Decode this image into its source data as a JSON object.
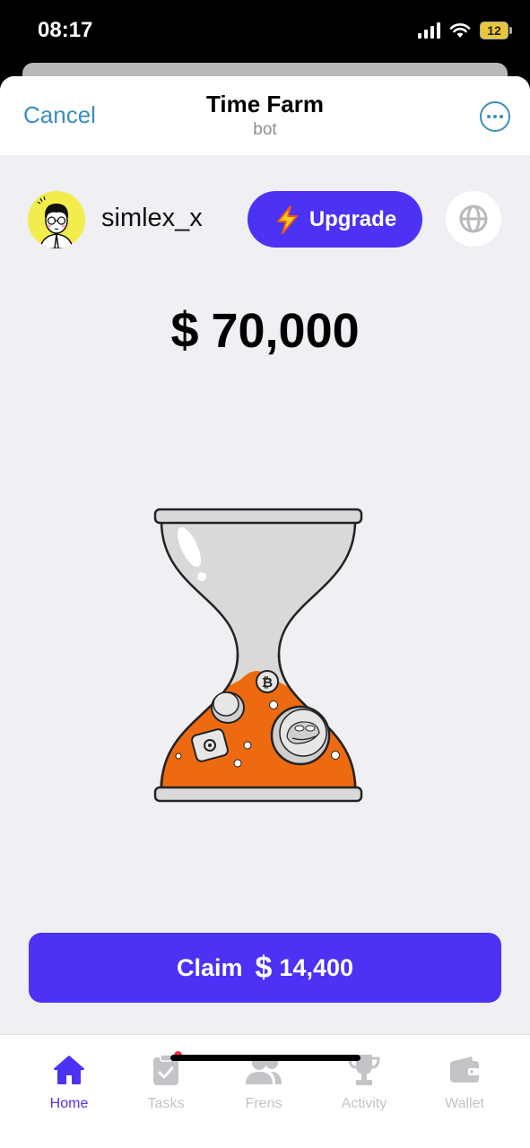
{
  "status_bar": {
    "time": "08:17",
    "battery": "12"
  },
  "header": {
    "cancel_label": "Cancel",
    "title": "Time Farm",
    "subtitle": "bot"
  },
  "user": {
    "username": "simlex_x"
  },
  "upgrade_button": {
    "label": "Upgrade",
    "icon": "lightning-icon"
  },
  "balance": {
    "currency_symbol": "$",
    "amount": "70,000"
  },
  "claim_button": {
    "label": "Claim",
    "currency_symbol": "$",
    "amount": "14,400"
  },
  "tabs": [
    {
      "label": "Home",
      "icon": "home-icon",
      "active": true
    },
    {
      "label": "Tasks",
      "icon": "clipboard-check-icon",
      "active": false,
      "badge": true
    },
    {
      "label": "Frens",
      "icon": "users-icon",
      "active": false
    },
    {
      "label": "Activity",
      "icon": "trophy-icon",
      "active": false
    },
    {
      "label": "Wallet",
      "icon": "wallet-icon",
      "active": false
    }
  ],
  "colors": {
    "accent": "#4b32f5",
    "telegram_blue": "#3a8ebf",
    "sand": "#ee6a10",
    "avatar_bg": "#f2ec4c"
  }
}
